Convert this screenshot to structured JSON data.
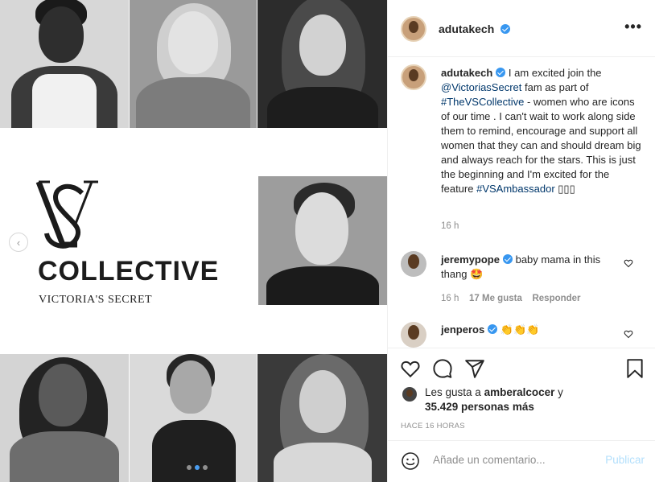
{
  "post": {
    "author": "adutakech",
    "more_label": "•••"
  },
  "media": {
    "logo": {
      "title": "COLLECTIVE",
      "subtitle": "VICTORIA'S SECRET"
    },
    "prev_label": "‹",
    "carousel_index": 2,
    "carousel_total": 3,
    "colors": {
      "dot_active": "#4a9df0"
    }
  },
  "caption": {
    "author": "adutakech",
    "text_1": " I am excited join the ",
    "mention": "@VictoriasSecret",
    "text_2": " fam as part of ",
    "hashtag_1": "#TheVSCollective",
    "text_3": " - women who are icons of our time . I can't wait to work along side them to remind, encourage and support all women that they can and should dream big and always reach for the stars.  This is just the beginning and I'm excited for the feature ",
    "hashtag_2": "#VSAmbassador",
    "text_4": " ▯▯▯",
    "time": "16 h"
  },
  "comments": [
    {
      "author": "jeremypope",
      "text": " baby mama in this thang 🤩",
      "time": "16 h",
      "likes": "17 Me gusta",
      "reply": "Responder"
    },
    {
      "author": "jenperos",
      "text": " 👏👏👏"
    }
  ],
  "likes": {
    "prefix": "Les gusta a ",
    "user": "amberalcocer",
    "suffix": " y",
    "count": "35.429 personas más"
  },
  "date": "HACE 16 HORAS",
  "composer": {
    "placeholder": "Añade un comentario...",
    "publish": "Publicar"
  },
  "icons": [
    "heart-icon",
    "comment-icon",
    "share-icon",
    "bookmark-icon",
    "emoji-icon",
    "more-icon",
    "verified-icon",
    "chevron-left-icon"
  ]
}
